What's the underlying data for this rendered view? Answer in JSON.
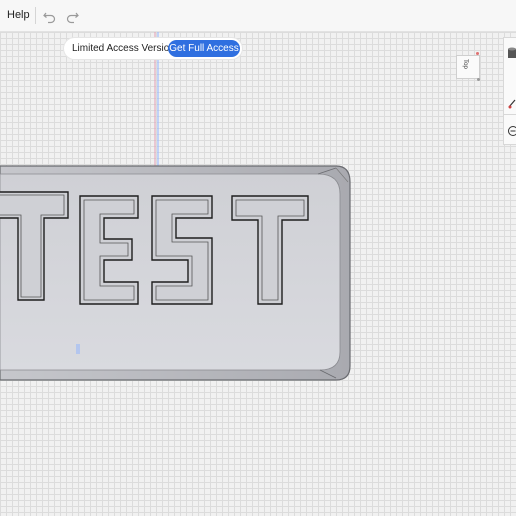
{
  "menu": {
    "help_label": "Help"
  },
  "toolbar": {
    "undo_icon": "undo-icon",
    "redo_icon": "redo-icon"
  },
  "access_banner": {
    "label": "Limited Access Version",
    "button_label": "Get Full Access",
    "button_color": "#2f6fe0"
  },
  "view_cube": {
    "face_label": "Top"
  },
  "model": {
    "text": "TEST",
    "body_color": "#d8d8dc"
  },
  "right_panel": {
    "icons": [
      "cylinder-icon",
      "measure-icon",
      "zoom-icon"
    ]
  }
}
